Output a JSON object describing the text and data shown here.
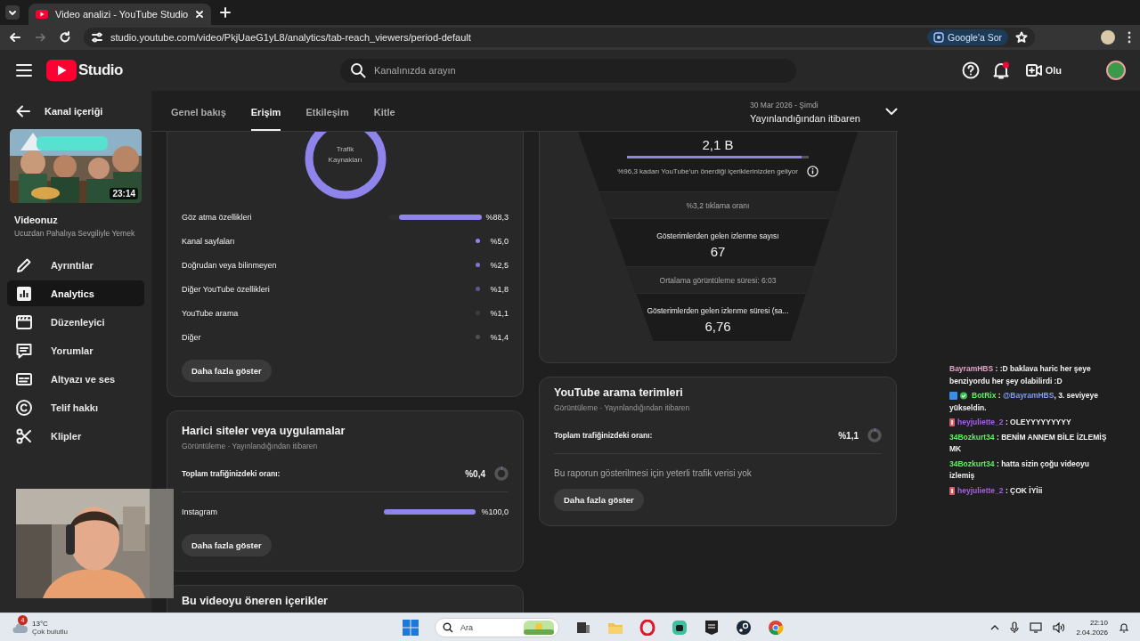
{
  "browser": {
    "tab_title": "Video analizi - YouTube Studio",
    "url": "studio.youtube.com/video/PkjUaeG1yL8/analytics/tab-reach_viewers/period-default",
    "ask_button": "Google'a Sor"
  },
  "header": {
    "logo_text": "Studio",
    "search_placeholder": "Kanalınızda arayın",
    "create_label": "Olu",
    "notification_dot": true
  },
  "sidebar": {
    "back_label": "Kanal içeriği",
    "thumbnail": {
      "kind": "picture",
      "duration": "23:14"
    },
    "video_title": "Videonuz",
    "video_subtitle": "Ucuzdan Pahalıya Sevgiliyle Yemek",
    "items": [
      {
        "label": "Ayrıntılar",
        "kind": "pencil",
        "selected": false
      },
      {
        "label": "Analytics",
        "kind": "chart",
        "selected": true
      },
      {
        "label": "Düzenleyici",
        "kind": "clapper",
        "selected": false
      },
      {
        "label": "Yorumlar",
        "kind": "comment",
        "selected": false
      },
      {
        "label": "Altyazı ve ses",
        "kind": "subtitles",
        "selected": false
      },
      {
        "label": "Telif hakkı",
        "kind": "copyright",
        "selected": false
      },
      {
        "label": "Klipler",
        "kind": "scissors",
        "selected": false
      }
    ]
  },
  "tabs": [
    {
      "label": "Genel bakış",
      "selected": false
    },
    {
      "label": "Erişim",
      "selected": true
    },
    {
      "label": "Etkileşim",
      "selected": false
    },
    {
      "label": "Kitle",
      "selected": false
    }
  ],
  "date_range": {
    "period": "30 Mar 2026 - Şimdi",
    "label": "Yayınlandığından itibaren"
  },
  "traffic_sources": {
    "donut_label": "Trafik Kaynakları",
    "rows": [
      {
        "label": "Göz atma özellikleri",
        "value": "%88,3",
        "kind": "bar",
        "level": 0.883
      },
      {
        "label": "Kanal sayfaları",
        "value": "%5,0",
        "kind": "dot",
        "color": "#8f84ec"
      },
      {
        "label": "Doğrudan veya bilinmeyen",
        "value": "%2,5",
        "kind": "dot",
        "color": "#7f76d0"
      },
      {
        "label": "Diğer YouTube özellikleri",
        "value": "%1,8",
        "kind": "dot",
        "color": "#5e5892"
      },
      {
        "label": "YouTube arama",
        "value": "%1,1",
        "kind": "dot",
        "color": "#3e3e3e"
      },
      {
        "label": "Diğer",
        "value": "%1,4",
        "kind": "dot",
        "color": "#505050"
      }
    ],
    "button": "Daha fazla göster"
  },
  "external_sites": {
    "title": "Harici siteler veya uygulamalar",
    "subtitle": "Görüntüleme · Yayınlandığından itibaren",
    "share": {
      "label": "Toplam trafiğinizdeki oranı:",
      "value": "%0,4",
      "level": 0.004
    },
    "rows": [
      {
        "label": "Instagram",
        "value": "%100,0",
        "kind": "bar",
        "level": 1
      }
    ],
    "button": "Daha fazla göster"
  },
  "next_card": {
    "title": "Bu videoyu öneren içerikler"
  },
  "funnel": {
    "impressions_value": "2,1 B",
    "recommended_bar": {
      "level": 0.963
    },
    "note": "%96,3 kadarı YouTube'un önerdiği içeriklerinizden geliyor",
    "ctr": "%3,2 tıklama oranı",
    "views_label": "Gösterimlerden gelen izlenme sayısı",
    "views_value": "67",
    "avg_duration": "Ortalama görüntüleme süresi: 6:03",
    "watch_label": "Gösterimlerden gelen izlenme süresi (sa...",
    "watch_value": "6,76"
  },
  "search_terms": {
    "title": "YouTube arama terimleri",
    "subtitle": "Görüntüleme · Yayınlandığından itibaren",
    "share": {
      "label": "Toplam trafiğinizdeki oranı:",
      "value": "%1,1",
      "level": 0.011
    },
    "empty_text": "Bu raporun gösterilmesi için yeterli trafik verisi yok",
    "button": "Daha fazla göster"
  },
  "chat": [
    {
      "user": "BayramHBS",
      "color": "#e0a3c8",
      "text": ": :D baklava haric her şeye benziyordu her şey olabilirdi :D"
    },
    {
      "user": "BotRix",
      "color": "#5ef05e",
      "kind": "bot",
      "text": ":",
      "mention": "@BayramHBS",
      "rest": ", 3. seviyeye yükseldin."
    },
    {
      "user": "heyjuliette_2",
      "color": "#a65ee8",
      "kind": "sub",
      "text": ": OLEYYYYYYYYY"
    },
    {
      "user": "34Bozkurt34",
      "color": "#5ef05e",
      "text": ": BENİM ANNEM BİLE İZLEMİŞ MK"
    },
    {
      "user": "34Bozkurt34",
      "color": "#5ef05e",
      "text": ": hatta sizin çoğu videoyu izlemiş"
    },
    {
      "user": "heyjuliette_2",
      "color": "#a65ee8",
      "kind": "sub",
      "text": ": ÇOK İYİii"
    }
  ],
  "taskbar": {
    "weather_badge": "4",
    "temperature": "13°C",
    "weather": "Çok bulutlu",
    "search_placeholder": "Ara",
    "time": "22:10",
    "date": "2.04.2026"
  }
}
